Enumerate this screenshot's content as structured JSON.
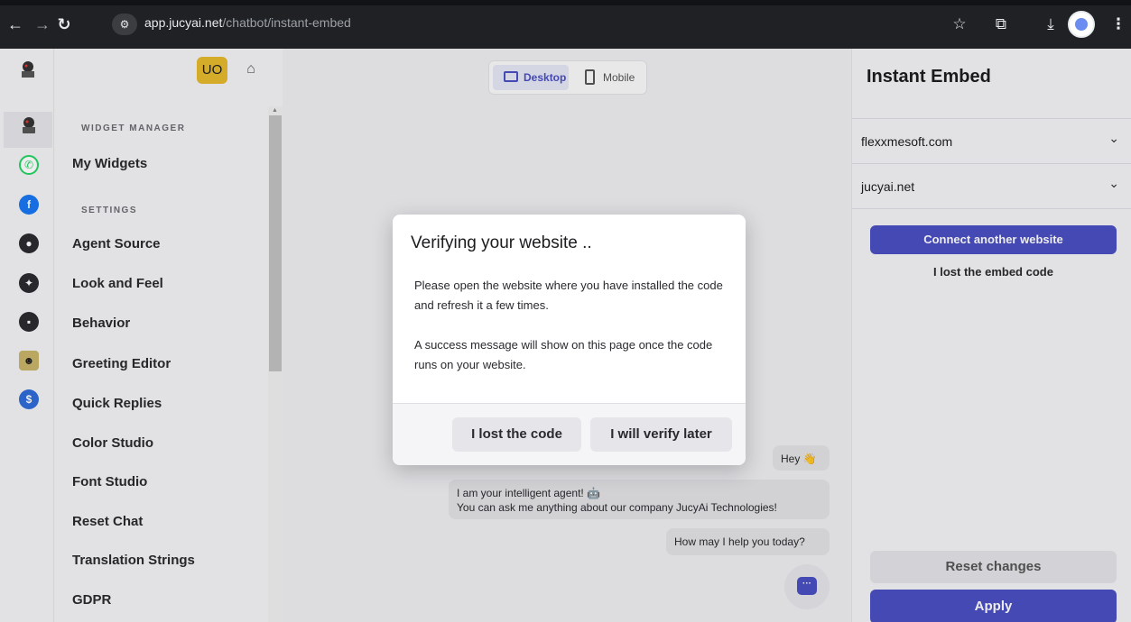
{
  "browser": {
    "url_host": "app.jucyai.net",
    "url_path": "/chatbot/instant-embed",
    "icons": [
      "back-arrow-icon",
      "forward-arrow-icon",
      "reload-icon",
      "site-info-icon",
      "star-icon",
      "extensions-icon",
      "download-icon",
      "profile-avatar",
      "kebab-menu-icon"
    ]
  },
  "rail": {
    "icons": [
      "jucyai-logo-icon",
      "whatsapp-icon",
      "facebook-icon",
      "agent-icon",
      "sparkle-icon",
      "chat-icon",
      "felix-icon",
      "dollar-icon"
    ]
  },
  "sidebar": {
    "avatar_initials": "UO",
    "section_widget_manager": "WIDGET MANAGER",
    "section_settings": "SETTINGS",
    "widget_items": [
      "My Widgets"
    ],
    "settings_items": [
      "Agent Source",
      "Look and Feel",
      "Behavior",
      "Greeting Editor",
      "Quick Replies",
      "Color Studio",
      "Font Studio",
      "Reset Chat",
      "Translation Strings",
      "GDPR"
    ]
  },
  "preview": {
    "device_desktop": "Desktop",
    "device_mobile": "Mobile",
    "msg_hey": "Hey 👋",
    "msg_intro_line1": "I am your intelligent agent! 🤖",
    "msg_intro_line2": "You can ask me anything about our company JucyAi Technologies!",
    "msg_help": "How may I help you today?"
  },
  "right_panel": {
    "title": "Instant Embed",
    "websites": [
      "flexxmesoft.com",
      "jucyai.net"
    ],
    "connect_button": "Connect another website",
    "lost_embed_link": "I lost the embed code",
    "reset_button": "Reset changes",
    "apply_button": "Apply"
  },
  "modal": {
    "title": "Verifying your website ..",
    "paragraph1": "Please open the website where you have installed the code and refresh it a few times.",
    "paragraph2": "A success message will show on this page once the code runs on your website.",
    "lost_code_button": "I lost the code",
    "verify_later_button": "I will verify later"
  },
  "colors": {
    "accent": "#4a4fc2",
    "avatar_bg": "#e6b82e",
    "chrome_bg": "#202124",
    "whatsapp": "#25d366",
    "facebook": "#1877f2",
    "dollar": "#2f6bd8"
  }
}
